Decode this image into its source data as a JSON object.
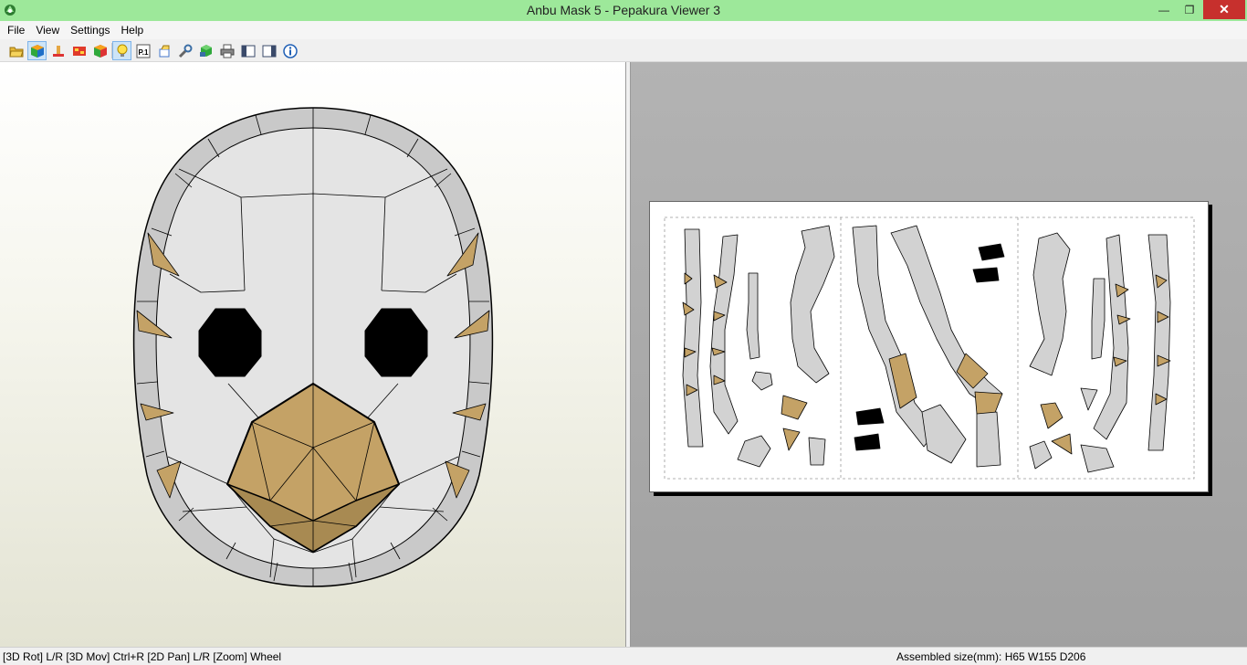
{
  "window": {
    "title": "Anbu Mask 5 - Pepakura Viewer 3",
    "close_glyph": "✕",
    "maximize_glyph": "❐",
    "minimize_glyph": "—"
  },
  "menu": {
    "items": [
      "File",
      "View",
      "Settings",
      "Help"
    ]
  },
  "toolbar": {
    "buttons": [
      {
        "icon": "open-folder-icon",
        "active": false
      },
      {
        "icon": "3d-cube-icon",
        "active": true
      },
      {
        "icon": "unfold-icon",
        "active": false
      },
      {
        "icon": "texture-icon",
        "active": false
      },
      {
        "icon": "color-cube-icon",
        "active": false
      },
      {
        "icon": "light-bulb-icon",
        "active": true
      },
      {
        "icon": "page-number-icon",
        "active": false,
        "label": "P.1"
      },
      {
        "icon": "flaps-icon",
        "active": false
      },
      {
        "icon": "settings-wrench-icon",
        "active": false
      },
      {
        "icon": "export-icon",
        "active": false
      },
      {
        "icon": "print-icon",
        "active": false
      },
      {
        "icon": "single-view-icon",
        "active": false
      },
      {
        "icon": "dual-view-icon",
        "active": false
      },
      {
        "icon": "info-icon",
        "active": false
      }
    ]
  },
  "status": {
    "left": "[3D Rot] L/R [3D Mov] Ctrl+R [2D Pan] L/R [Zoom] Wheel",
    "right": "Assembled size(mm): H65 W155 D206"
  },
  "colors": {
    "titlebar": "#9de89a",
    "close": "#c7302d",
    "mask_face": "#e4e4e4",
    "mask_rim": "#c9c9c9",
    "beak": "#c4a266",
    "beak_dark": "#a88a52",
    "eye": "#000000"
  }
}
